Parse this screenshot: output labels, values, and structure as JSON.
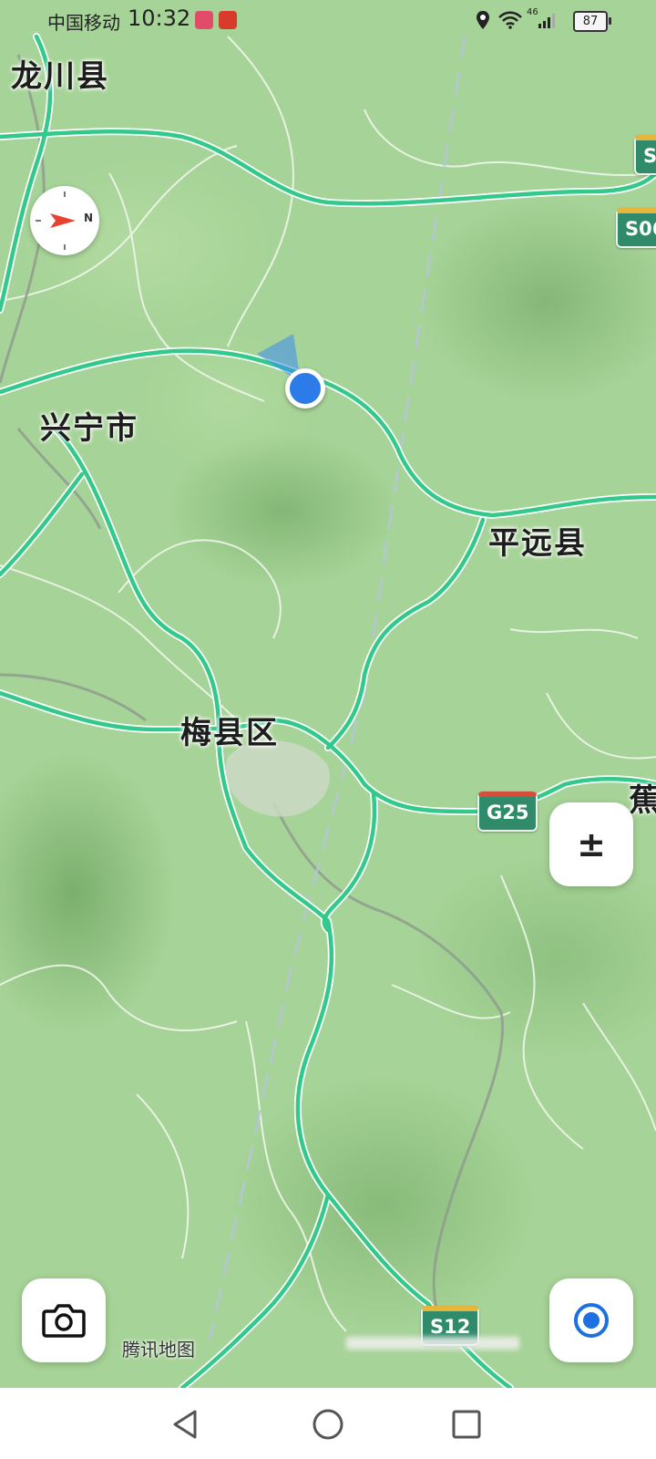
{
  "status_bar": {
    "carrier": "中国移动",
    "time": "10:32",
    "network": "46",
    "battery": "87"
  },
  "map": {
    "places": {
      "longchuan": "龙川县",
      "xingning": "兴宁市",
      "pingyuan": "平远县",
      "meixian": "梅县区",
      "jiao": "蕉"
    },
    "roads": {
      "g25": "G25",
      "s06_top": "S",
      "s06": "S06",
      "s12": "S12"
    },
    "attribution": "腾讯地图",
    "road_color": "#33c98a",
    "location_color": "#2b7be8"
  },
  "controls": {
    "zoom_label": "±",
    "compass_label": "N",
    "compass_icon": "compass-icon",
    "camera_icon": "camera-icon",
    "locate_icon": "locate-icon"
  },
  "nav_bar": {
    "icons": [
      "back-triangle-icon",
      "home-circle-icon",
      "recents-square-icon"
    ]
  }
}
